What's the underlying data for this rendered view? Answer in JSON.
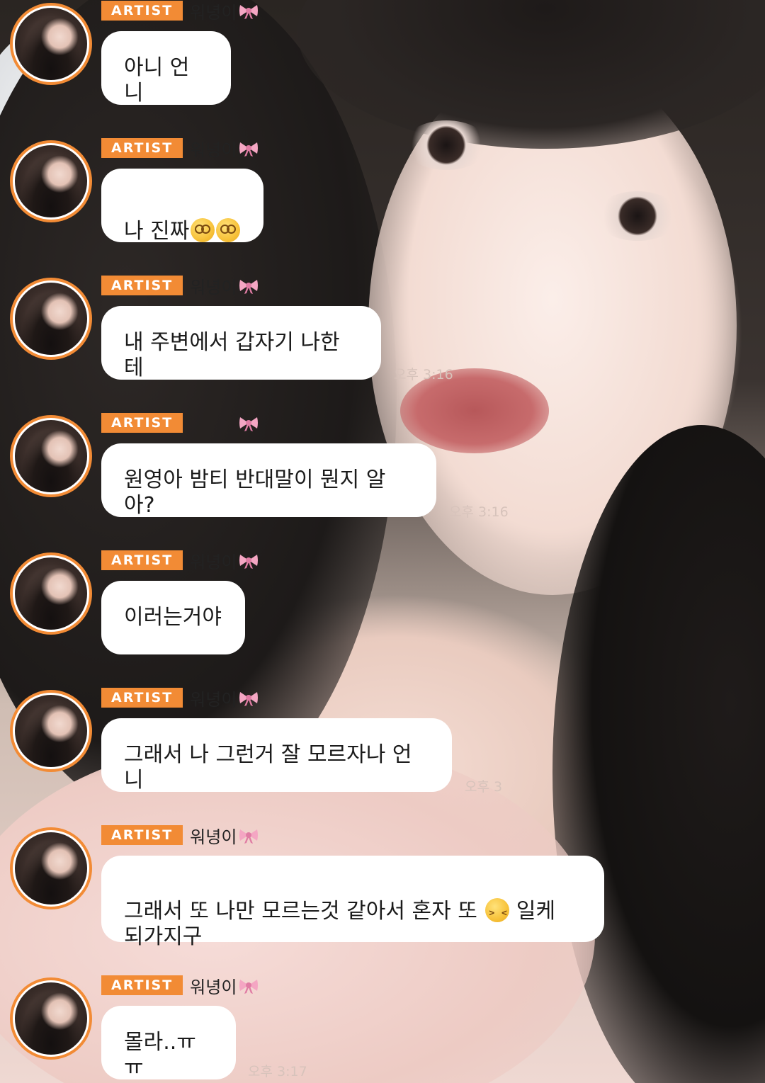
{
  "chat": {
    "badge_label": "ARTIST",
    "username": "워녕이",
    "messages": [
      {
        "text": "아니 언니",
        "time": ""
      },
      {
        "text": "나 진짜",
        "time": ""
      },
      {
        "text": "내 주변에서 갑자기 나한테",
        "time": "오후 3:16"
      },
      {
        "text": "원영아 밤티 반대말이 뭔지 알아?",
        "time": "오후 3:16"
      },
      {
        "text": "이러는거야",
        "time": ""
      },
      {
        "text": "그래서 나 그런거 잘 모르자나 언니",
        "time": "오후 3"
      },
      {
        "text_before": "그래서 또 나만 모르는것 같아서 혼자 또 ",
        "text_after": " 일케\n되가지구",
        "time": ""
      },
      {
        "text": "몰라..ㅠㅠ",
        "time": "오후 3:17"
      }
    ]
  },
  "colors": {
    "accent": "#f28b35",
    "bubble": "#ffffff",
    "text": "#1b1b1b"
  },
  "icons": {
    "badge_decoration": "pink-ribbon-icon",
    "emoji_1": "dizzy-face-icon",
    "emoji_2": "confounded-face-icon"
  }
}
